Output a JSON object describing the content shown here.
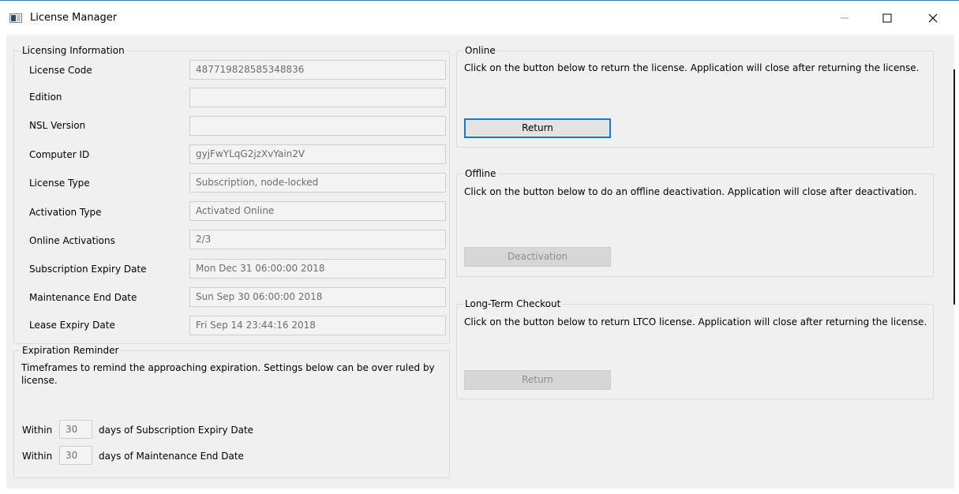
{
  "window": {
    "title": "License Manager",
    "app_icon": "license-manager-app-icon",
    "controls": {
      "minimize_icon": "minimize-icon",
      "maximize_icon": "maximize-icon",
      "close_icon": "close-icon"
    }
  },
  "licensing": {
    "legend": "Licensing Information",
    "rows": [
      {
        "label": "License Code",
        "value": "487719828585348836"
      },
      {
        "label": "Edition",
        "value": ""
      },
      {
        "label": "NSL Version",
        "value": ""
      },
      {
        "label": "Computer ID",
        "value": "gyjFwYLqG2jzXvYain2V"
      },
      {
        "label": "License Type",
        "value": "Subscription, node-locked"
      },
      {
        "label": "Activation Type",
        "value": "Activated Online"
      },
      {
        "label": "Online Activations",
        "value": "2/3"
      },
      {
        "label": "Subscription Expiry Date",
        "value": "Mon Dec 31 06:00:00 2018"
      },
      {
        "label": "Maintenance End Date",
        "value": "Sun Sep 30 06:00:00 2018"
      },
      {
        "label": "Lease Expiry Date",
        "value": "Fri Sep 14 23:44:16 2018"
      }
    ]
  },
  "reminder": {
    "legend": "Expiration Reminder",
    "description": "Timeframes to remind the approaching expiration. Settings below can be over ruled by license.",
    "subscription": {
      "prefix": "Within",
      "days": "30",
      "suffix": "days of Subscription Expiry Date"
    },
    "maintenance": {
      "prefix": "Within",
      "days": "30",
      "suffix": "days of Maintenance End Date"
    }
  },
  "online": {
    "legend": "Online",
    "description": "Click on the button below to return the license. Application will close after returning the license.",
    "button": "Return"
  },
  "offline": {
    "legend": "Offline",
    "description": "Click on the button below to do an offline deactivation. Application will close after deactivation.",
    "button": "Deactivation"
  },
  "ltco": {
    "legend": "Long-Term Checkout",
    "description": "Click on the button below to return LTCO license. Application will close after returning the license.",
    "button": "Return"
  },
  "colors": {
    "accent": "#0f7ad8",
    "panel": "#f0f0f0",
    "title_border": "#3c7fb1"
  }
}
